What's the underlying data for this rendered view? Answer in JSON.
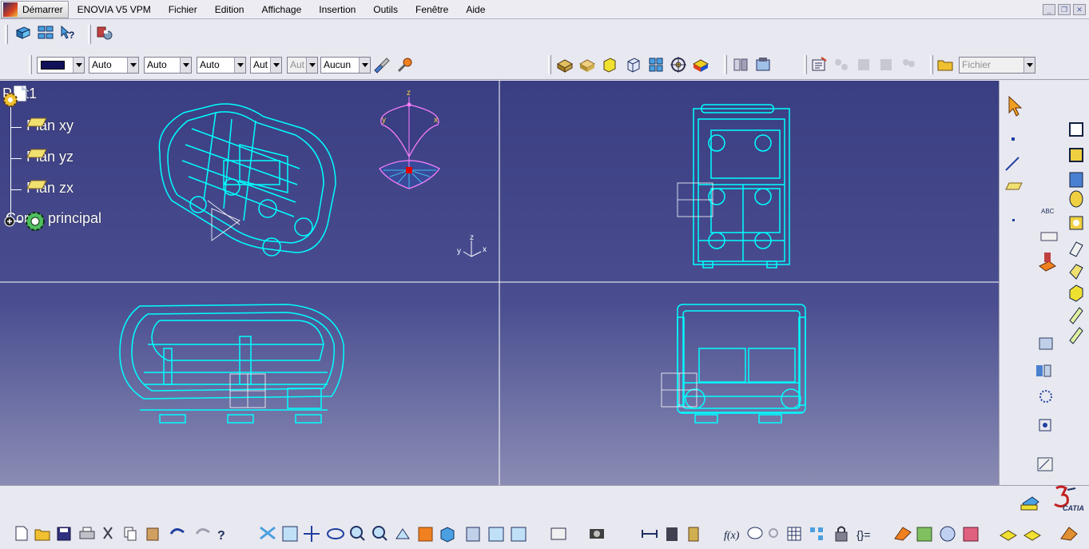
{
  "menubar": {
    "start": "Démarrer",
    "items": [
      "ENOVIA V5 VPM",
      "Fichier",
      "Edition",
      "Affichage",
      "Insertion",
      "Outils",
      "Fenêtre",
      "Aide"
    ]
  },
  "graphic_properties": {
    "color": "#10105a",
    "transparency": "Auto",
    "line_weight": "Auto",
    "line_type": "Auto",
    "point_symbol": "Aut",
    "render_style": "Aut",
    "layer": "Aucun"
  },
  "file_combo": "Fichier",
  "tree": {
    "root": "Part1",
    "children": [
      "Plan xy",
      "Plan yz",
      "Plan zx",
      "Corps principal"
    ]
  },
  "compass": {
    "z_label": "z",
    "x_label": "x",
    "y_label": "y"
  },
  "axis_triad": {
    "z": "z",
    "x": "x",
    "y": "y"
  },
  "right_toolbar": {
    "annotation_label": "ABC"
  },
  "brand": {
    "logo_text": "CATIA"
  },
  "colors": {
    "wireframe": "#00ffff",
    "viewport_top": "#3a3e82",
    "viewport_bottom": "#8a8cb4"
  }
}
